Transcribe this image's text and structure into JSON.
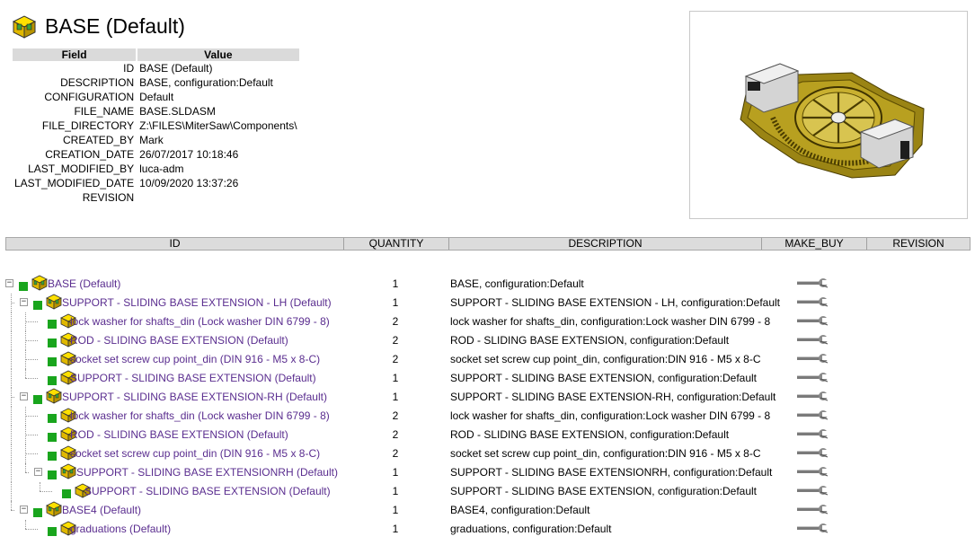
{
  "header": {
    "title": "BASE (Default)",
    "icon": "assembly-icon"
  },
  "properties": {
    "col_field": "Field",
    "col_value": "Value",
    "rows": [
      {
        "field": "ID",
        "value": "BASE (Default)"
      },
      {
        "field": "DESCRIPTION",
        "value": "BASE, configuration:Default"
      },
      {
        "field": "CONFIGURATION",
        "value": "Default"
      },
      {
        "field": "FILE_NAME",
        "value": "BASE.SLDASM"
      },
      {
        "field": "FILE_DIRECTORY",
        "value": "Z:\\FILES\\MiterSaw\\Components\\"
      },
      {
        "field": "CREATED_BY",
        "value": "Mark"
      },
      {
        "field": "CREATION_DATE",
        "value": "26/07/2017 10:18:46"
      },
      {
        "field": "LAST_MODIFIED_BY",
        "value": "luca-adm"
      },
      {
        "field": "LAST_MODIFIED_DATE",
        "value": "10/09/2020 13:37:26"
      },
      {
        "field": "REVISION",
        "value": ""
      }
    ]
  },
  "preview": {
    "subject": "3D model thumbnail of BASE assembly",
    "color": "#b8a020"
  },
  "bom": {
    "columns": [
      "ID",
      "QUANTITY",
      "DESCRIPTION",
      "MAKE_BUY",
      "REVISION"
    ],
    "rows": [
      {
        "id": "BASE (Default)",
        "qty": "1",
        "desc": "BASE, configuration:Default",
        "level": 0,
        "expandable": true,
        "kind": "assembly"
      },
      {
        "id": "SUPPORT - SLIDING BASE EXTENSION - LH (Default)",
        "qty": "1",
        "desc": "SUPPORT - SLIDING BASE EXTENSION - LH, configuration:Default",
        "level": 1,
        "expandable": true,
        "kind": "assembly"
      },
      {
        "id": "lock washer for shafts_din (Lock washer DIN 6799 - 8)",
        "qty": "2",
        "desc": "lock washer for shafts_din, configuration:Lock washer DIN 6799 - 8",
        "level": 2,
        "expandable": false,
        "kind": "part"
      },
      {
        "id": "ROD - SLIDING BASE EXTENSION (Default)",
        "qty": "2",
        "desc": "ROD - SLIDING BASE EXTENSION, configuration:Default",
        "level": 2,
        "expandable": false,
        "kind": "part"
      },
      {
        "id": "socket set screw cup point_din (DIN 916 - M5 x 8-C)",
        "qty": "2",
        "desc": "socket set screw cup point_din, configuration:DIN 916 - M5 x 8-C",
        "level": 2,
        "expandable": false,
        "kind": "part"
      },
      {
        "id": "SUPPORT - SLIDING BASE EXTENSION (Default)",
        "qty": "1",
        "desc": "SUPPORT - SLIDING BASE EXTENSION, configuration:Default",
        "level": 2,
        "expandable": false,
        "kind": "part"
      },
      {
        "id": "SUPPORT - SLIDING BASE EXTENSION-RH (Default)",
        "qty": "1",
        "desc": "SUPPORT - SLIDING BASE EXTENSION-RH, configuration:Default",
        "level": 1,
        "expandable": true,
        "kind": "assembly"
      },
      {
        "id": "lock washer for shafts_din (Lock washer DIN 6799 - 8)",
        "qty": "2",
        "desc": "lock washer for shafts_din, configuration:Lock washer DIN 6799 - 8",
        "level": 2,
        "expandable": false,
        "kind": "part"
      },
      {
        "id": "ROD - SLIDING BASE EXTENSION (Default)",
        "qty": "2",
        "desc": "ROD - SLIDING BASE EXTENSION, configuration:Default",
        "level": 2,
        "expandable": false,
        "kind": "part"
      },
      {
        "id": "socket set screw cup point_din (DIN 916 - M5 x 8-C)",
        "qty": "2",
        "desc": "socket set screw cup point_din, configuration:DIN 916 - M5 x 8-C",
        "level": 2,
        "expandable": false,
        "kind": "part"
      },
      {
        "id": "SUPPORT - SLIDING BASE EXTENSIONRH (Default)",
        "qty": "1",
        "desc": "SUPPORT - SLIDING BASE EXTENSIONRH, configuration:Default",
        "level": 2,
        "expandable": true,
        "kind": "assembly"
      },
      {
        "id": "SUPPORT - SLIDING BASE EXTENSION (Default)",
        "qty": "1",
        "desc": "SUPPORT - SLIDING BASE EXTENSION, configuration:Default",
        "level": 3,
        "expandable": false,
        "kind": "part"
      },
      {
        "id": "BASE4 (Default)",
        "qty": "1",
        "desc": "BASE4, configuration:Default",
        "level": 1,
        "expandable": true,
        "kind": "assembly"
      },
      {
        "id": "graduations (Default)",
        "qty": "1",
        "desc": "graduations, configuration:Default",
        "level": 2,
        "expandable": false,
        "kind": "part"
      }
    ],
    "make_buy_icon": "wrench-icon",
    "status_color": "#19a51d",
    "link_color": "#5a2d8f"
  }
}
